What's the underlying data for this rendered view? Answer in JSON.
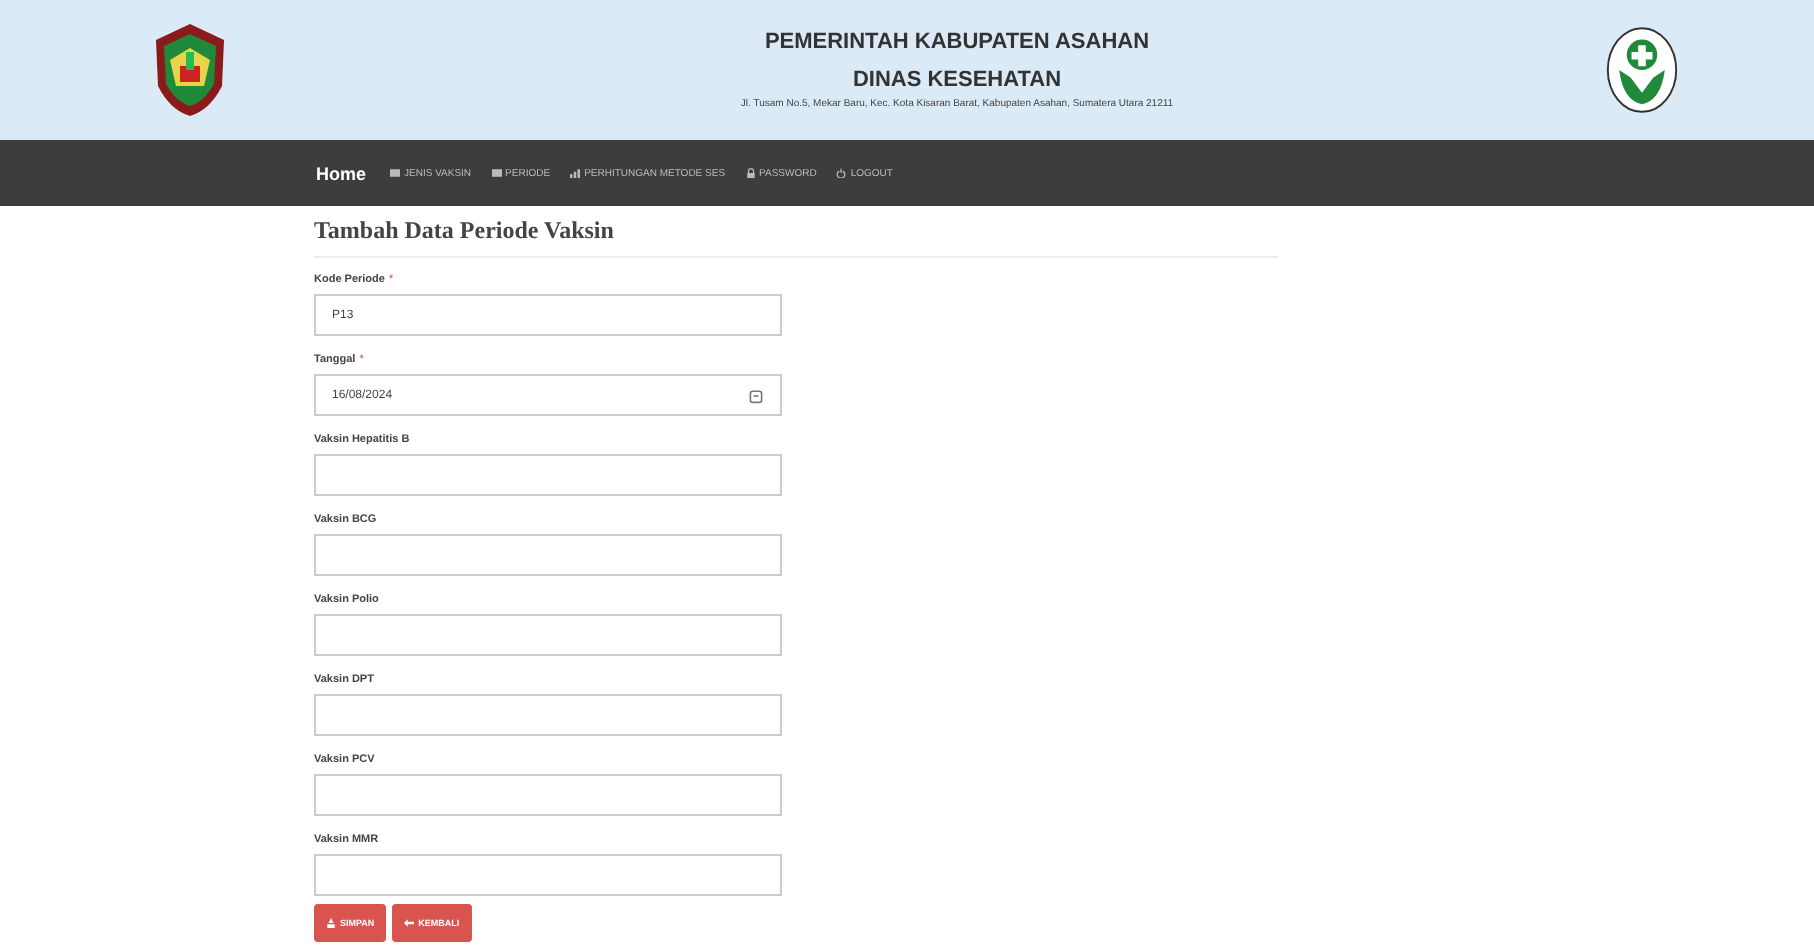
{
  "header": {
    "title": "PEMERINTAH KABUPATEN ASAHAN",
    "subtitle": "DINAS KESEHATAN",
    "address": "Jl. Tusam No.5, Mekar Baru, Kec. Kota Kisaran Barat, Kabupaten Asahan, Sumatera Utara 21211"
  },
  "nav": [
    {
      "label": "Home",
      "selected": true
    },
    {
      "label": "JENIS VAKSIN",
      "selected": false
    },
    {
      "label": "PERIODE",
      "selected": false
    },
    {
      "label": "PERHITUNGAN METODE SES",
      "selected": false
    },
    {
      "label": "PASSWORD",
      "selected": false
    },
    {
      "label": "LOGOUT",
      "selected": false
    }
  ],
  "form": {
    "title": "Tambah Data Periode Vaksin",
    "fields": [
      {
        "label": "Kode Periode",
        "required_mark": "*",
        "value": "P13",
        "kind": "text"
      },
      {
        "label": "Tanggal",
        "required_mark": "*",
        "value": "16/08/2024",
        "kind": "date"
      },
      {
        "label": "Vaksin Hepatitis B",
        "kind": "text"
      },
      {
        "label": "Vaksin BCG",
        "kind": "text"
      },
      {
        "label": "Vaksin Polio",
        "kind": "text"
      },
      {
        "label": "Vaksin DPT",
        "kind": "text"
      },
      {
        "label": "Vaksin PCV",
        "kind": "text"
      },
      {
        "label": "Vaksin MMR",
        "kind": "text"
      }
    ],
    "buttons": [
      {
        "label": "SIMPAN"
      },
      {
        "label": "KEMBALI"
      }
    ]
  }
}
